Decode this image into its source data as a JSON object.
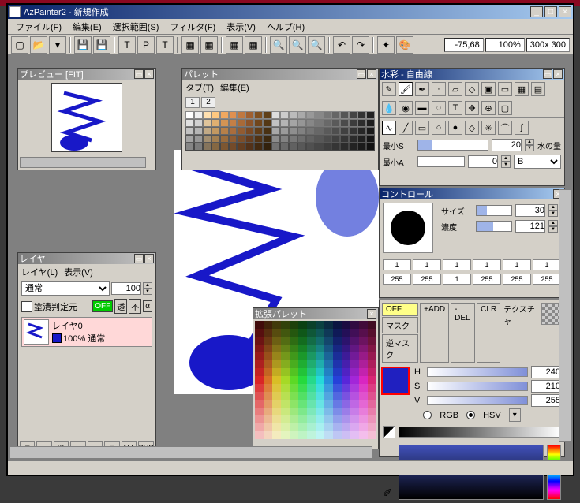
{
  "window": {
    "title": "AzPainter2 - 新規作成"
  },
  "menu": {
    "file": "ファイル(F)",
    "edit": "編集(E)",
    "select": "選択範囲(S)",
    "filter": "フィルタ(F)",
    "view": "表示(V)",
    "help": "ヘルプ(H)"
  },
  "status": {
    "coord": "-75,68",
    "zoom": "100%",
    "size": "300x 300"
  },
  "preview": {
    "title": "プレビュー [FIT]"
  },
  "layer": {
    "title": "レイヤ",
    "menu_layer": "レイヤ(L)",
    "menu_view": "表示(V)",
    "mode": "通常",
    "opacity": "100",
    "alpha_label": "塗潰判定元",
    "off": "OFF",
    "t1": "透",
    "t2": "不",
    "t3": "α",
    "item": {
      "name": "レイヤ0",
      "desc": "100% 通常"
    },
    "btns": {
      "new": "□",
      "del": "▬",
      "up": "▲",
      "down": "▼",
      "all": "ALL",
      "cur": "CUR"
    }
  },
  "palette": {
    "title": "パレット",
    "tab_menu": "タブ(T)",
    "edit_menu": "編集(E)",
    "tab1": "1",
    "tab2": "2"
  },
  "ext_palette": {
    "title": "拡張パレット"
  },
  "tool": {
    "title": "水彩 - 自由線",
    "minS": "最小S",
    "minS_val": "20",
    "water": "水の量",
    "minA": "最小A",
    "minA_val": "0",
    "b": "B"
  },
  "ctrl": {
    "title": "コントロール",
    "size": "サイズ",
    "size_val": "30",
    "dens": "濃度",
    "dens_val": "121",
    "boxes": [
      "1",
      "1",
      "1",
      "1",
      "1",
      "1"
    ],
    "vals": [
      "255",
      "255",
      "1",
      "255",
      "255",
      "255"
    ]
  },
  "mask": {
    "off": "OFF",
    "add": "+ADD",
    "del": "-DEL",
    "clr": "CLR",
    "mask": "マスク",
    "rmask": "逆マスク",
    "tex": "テクスチャ",
    "h": "H",
    "h_val": "240",
    "s": "S",
    "s_val": "210",
    "v": "V",
    "v_val": "255",
    "rgb": "RGB",
    "hsv": "HSV"
  }
}
